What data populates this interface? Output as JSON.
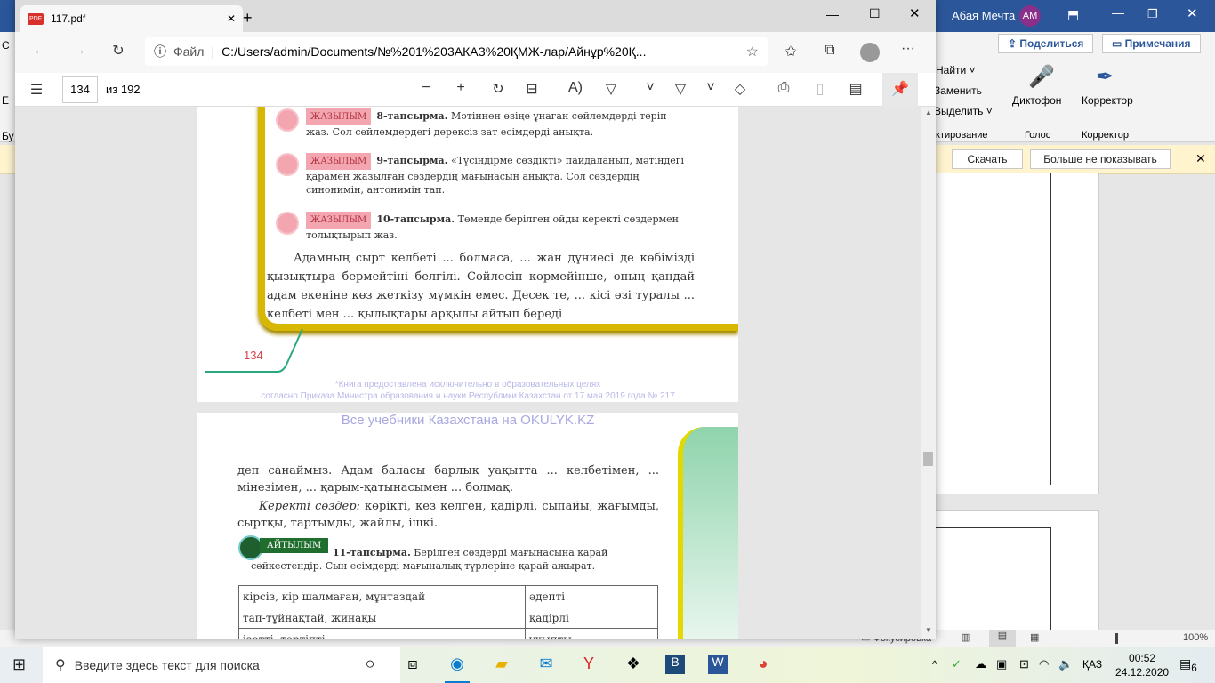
{
  "word": {
    "user": "Абая Мечта",
    "initials": "AM",
    "share": "Поделиться",
    "comments": "Примечания",
    "find": "Найти",
    "replace": "Заменить",
    "select": "Выделить",
    "editing_group": "ктирование",
    "dictate": "Диктофон",
    "voice_group": "Голос",
    "editor": "Корректор",
    "editor_group": "Корректор",
    "download": "Скачать",
    "dont_show": "Больше не показывать",
    "focus": "Фокусировка",
    "zoom": "100%",
    "left_a": "С",
    "left_b": "Е",
    "left_c": "Бу"
  },
  "edge": {
    "tab_title": "117.pdf",
    "file_label": "Файл",
    "url": "C:/Users/admin/Documents/№%201%203АКАЗ%20ҚМЖ-лар/Айнұр%20Қ...",
    "page_num": "134",
    "page_total": "из 192"
  },
  "page1": {
    "tag": "ЖАЗЫЛЫМ",
    "t8b": "8-тапсырма.",
    "t8": " Мәтіннен өзіңе ұнаған сөйлемдерді теріп жаз. Сол сөйлемдердегі дерексіз зат есімдерді анықта.",
    "t9b": "9-тапсырма.",
    "t9": " «Түсіндірме сөздікті» пайдаланып, мәтіндегі қарамен жазылған сөздердің мағынасын анықта. Сол сөздердің синонимін, антонимін тап.",
    "t10b": "10-тапсырма.",
    "t10": " Төменде берілген ойды керекті сөздермен толықтырып жаз.",
    "body": "Адамның сырт келбеті ... болмаса, ... жан дүниесі де көбімізді қызықтыра бермейтіні белгілі. Сөйлесіп көрмейінше, оның қандай адам екеніне көз жеткізу мүмкін емес. Десек те, ... кісі өзі туралы ... келбеті мен ... қылықтары арқылы айтып береді",
    "page_no": "134",
    "foot1": "*Книга предоставлена исключительно в образовательных целях",
    "foot2": "согласно Приказа Министра образования и науки Республики Казахстан от 17 мая 2019 года № 217"
  },
  "page2": {
    "watermark": "Все учебники Казахстана на OKULYK.KZ",
    "body1": "деп санаймыз. Адам баласы барлық уақытта ... келбетімен, ... мінезімен, ... қарым-қатынасымен ... болмақ.",
    "kw_label": "Керекті сөздер:",
    "kw": " көрікті, кез келген, қадірлі, сыпайы, жағымды, сыртқы, тартымды, жайлы, ішкі.",
    "tag": "АЙТЫЛЫМ",
    "t11b": "11-тапсырма.",
    "t11": " Берілген сөздерді мағынасына қарай сәйкестендір. Сын есімдерді мағыналық түрлеріне қарай ажырат.",
    "rows": [
      [
        "кірсіз, кір шалмаған, мұнтаздай",
        "әдепті"
      ],
      [
        "тап-тұйнақтай, жинақы",
        "қадірлі"
      ],
      [
        "ізетті, тәртіпті",
        "ұқыпты"
      ]
    ]
  },
  "taskbar": {
    "search": "Введите здесь текст для поиска",
    "time": "00:52",
    "date": "24.12.2020",
    "lang": "ҚАЗ",
    "notif": "6"
  }
}
